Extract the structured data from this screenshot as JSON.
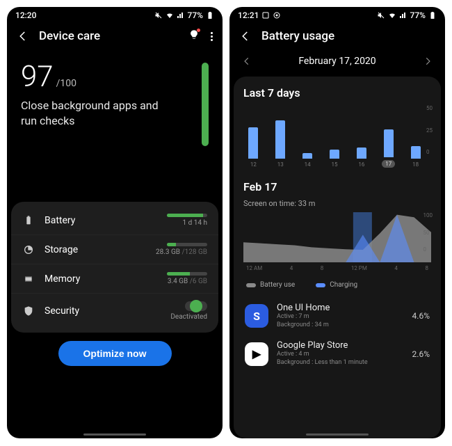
{
  "left": {
    "status": {
      "time": "12:20",
      "battery_pct": "77%"
    },
    "header": {
      "title": "Device care"
    },
    "score": {
      "value": "97",
      "denom": "/100",
      "message": "Close background apps and run checks"
    },
    "rows": {
      "battery": {
        "label": "Battery",
        "text": "1 d 14 h",
        "fill_pct": 90
      },
      "storage": {
        "label": "Storage",
        "used": "28.3 GB",
        "total": "/128 GB",
        "fill_pct": 22
      },
      "memory": {
        "label": "Memory",
        "used": "3.4 GB",
        "total": "/6 GB",
        "fill_pct": 57
      },
      "security": {
        "label": "Security",
        "text": "Deactivated"
      }
    },
    "optimize": "Optimize now"
  },
  "right": {
    "status": {
      "time": "12:21",
      "battery_pct": "77%"
    },
    "header": {
      "title": "Battery usage"
    },
    "date": "February 17, 2020",
    "last7": {
      "title": "Last 7 days"
    },
    "today": {
      "title": "Feb 17",
      "screen_on": "Screen on time: 33 m"
    },
    "legend": {
      "battery": "Battery use",
      "charging": "Charging"
    },
    "apps": [
      {
        "name": "One UI Home",
        "active": "Active : 7 m",
        "bg": "Background : 34 m",
        "pct": "4.6%",
        "color": "#2b5ce0",
        "icon": "S"
      },
      {
        "name": "Google Play Store",
        "active": "Active : 4 m",
        "bg": "Background : Less than 1 minute",
        "pct": "2.6%",
        "color": "#fff",
        "icon": "▶"
      }
    ]
  },
  "chart_data": [
    {
      "type": "bar",
      "title": "Last 7 days",
      "categories": [
        "12",
        "13",
        "14",
        "15",
        "16",
        "17",
        "18"
      ],
      "values": [
        34,
        42,
        6,
        10,
        12,
        30,
        14
      ],
      "ylabel": "%",
      "ylim": [
        0,
        50
      ],
      "yticks": [
        0,
        25,
        50
      ],
      "selected_index": 5
    },
    {
      "type": "area",
      "title": "Feb 17",
      "x": [
        "12 AM",
        "4",
        "8",
        "12 PM",
        "4",
        "8"
      ],
      "series": [
        {
          "name": "Battery use",
          "color": "#8a8a8a",
          "values": [
            40,
            38,
            36,
            34,
            30,
            28,
            26,
            25,
            58,
            95,
            90,
            60
          ]
        },
        {
          "name": "Charging",
          "color": "#5a8dff",
          "values": [
            0,
            0,
            0,
            0,
            0,
            0,
            0,
            55,
            0,
            95,
            0,
            0
          ]
        }
      ],
      "ylabel": "%",
      "ylim": [
        0,
        100
      ],
      "yticks": [
        0,
        50,
        100
      ]
    }
  ]
}
